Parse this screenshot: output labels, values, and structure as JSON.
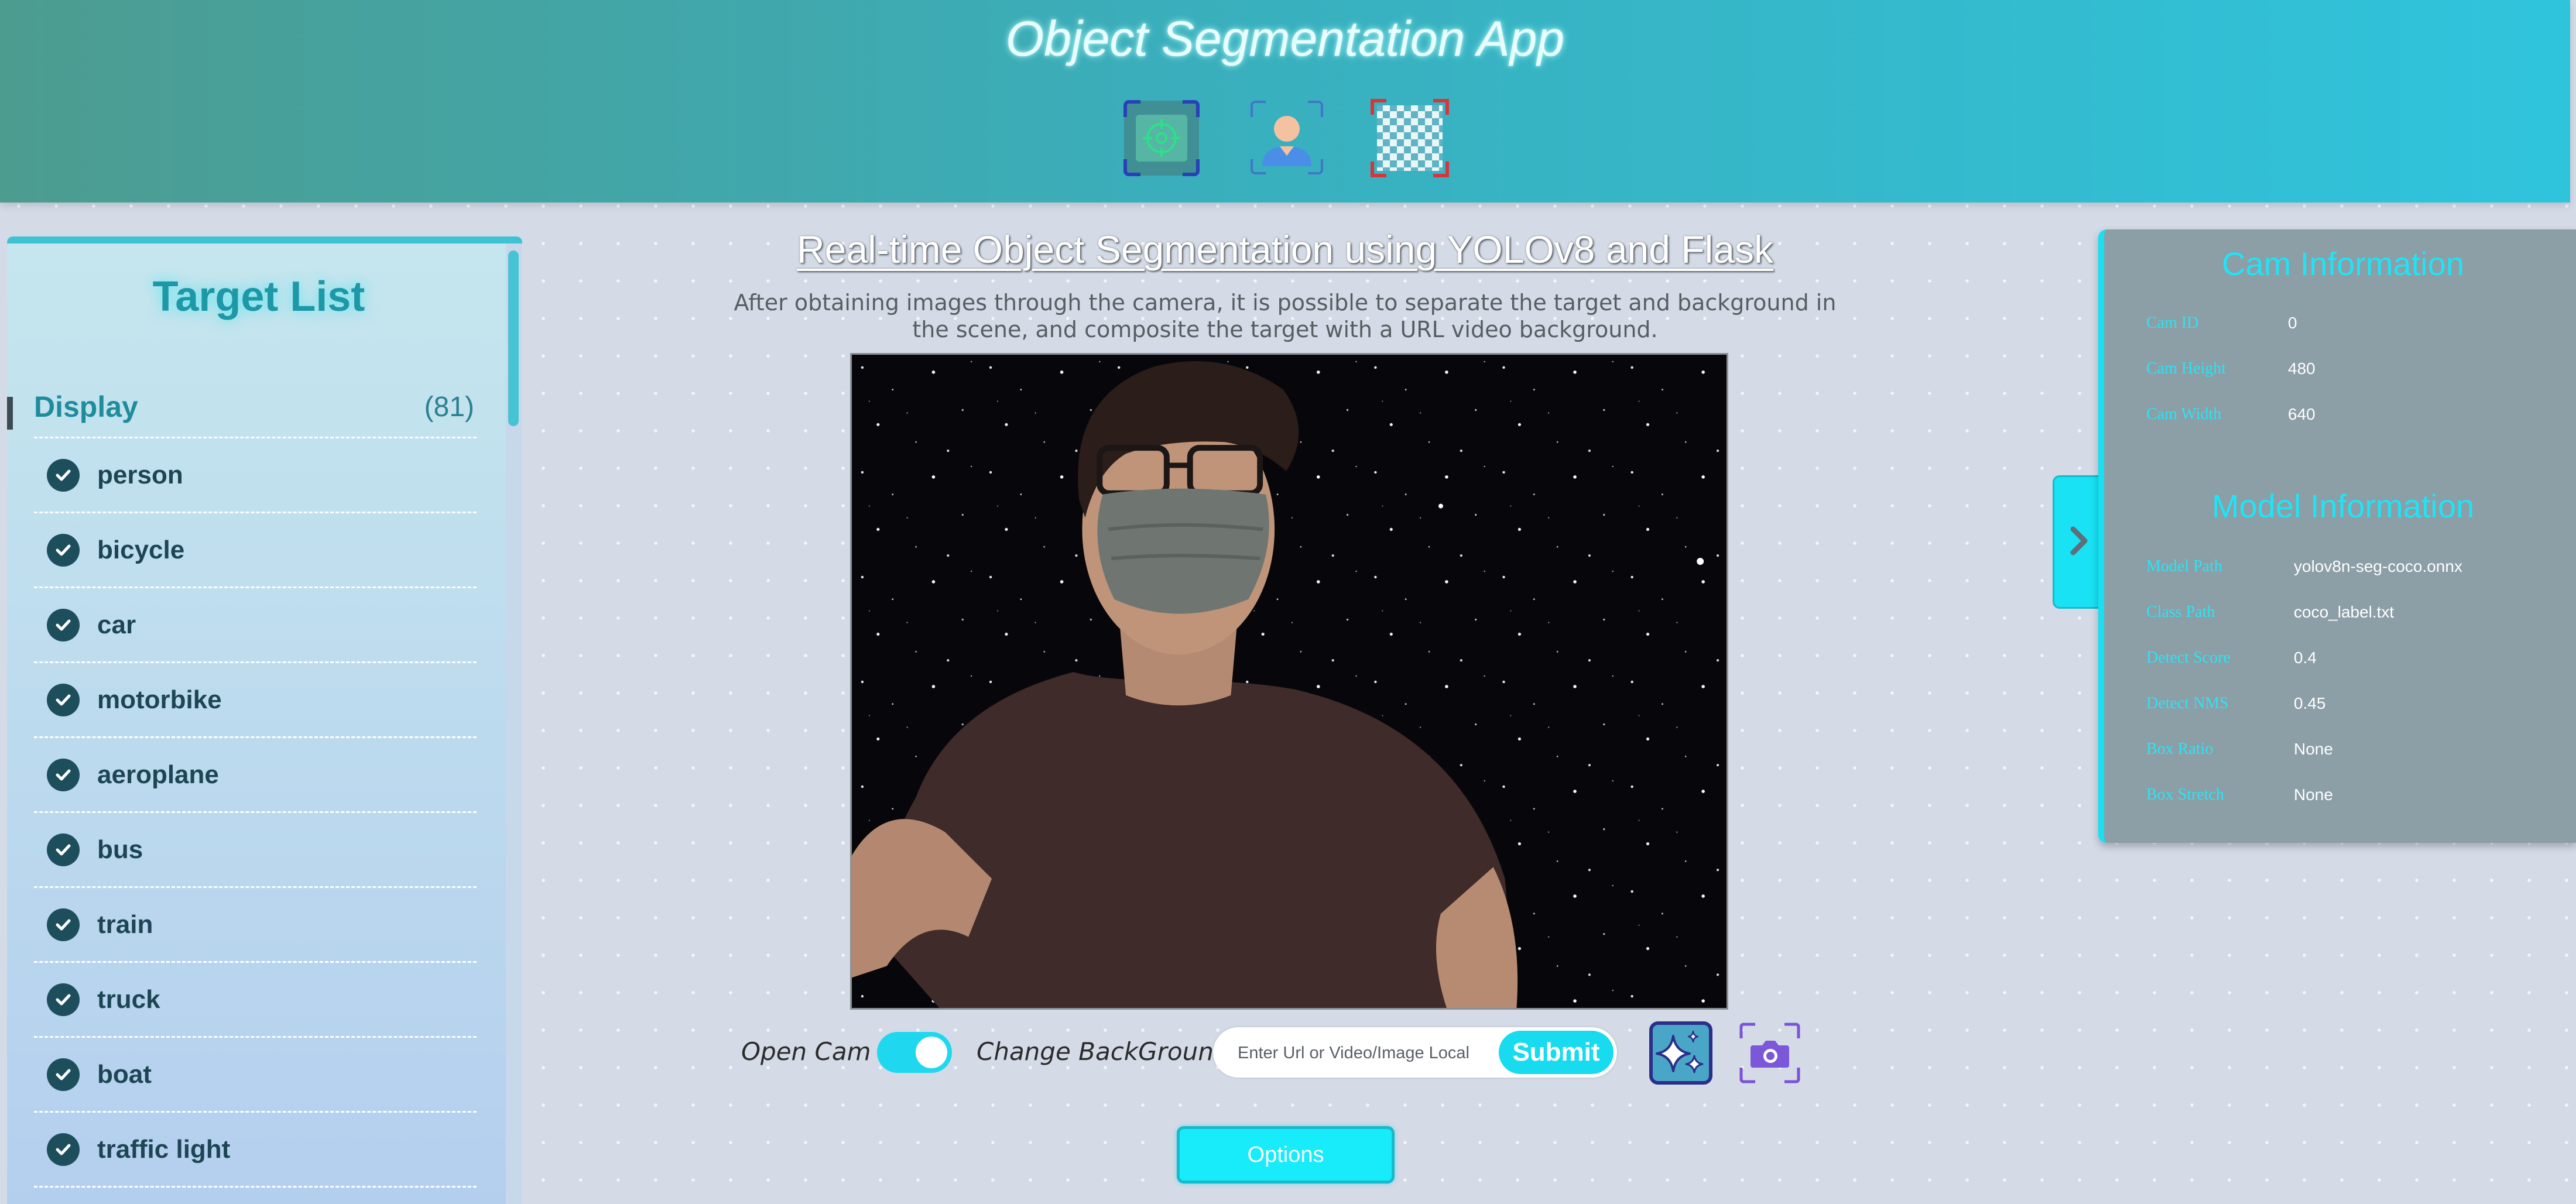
{
  "header": {
    "title": "Object Segmentation App",
    "mode_buttons": [
      {
        "name": "detection",
        "icon": "target-scan-icon"
      },
      {
        "name": "segmentation",
        "icon": "person-portrait-icon"
      },
      {
        "name": "background-removal",
        "icon": "checkerboard-icon"
      }
    ]
  },
  "sidebar": {
    "title": "Target List",
    "group": {
      "label": "Display",
      "count": "(81)"
    },
    "items": [
      {
        "label": "person",
        "checked": true
      },
      {
        "label": "bicycle",
        "checked": true
      },
      {
        "label": "car",
        "checked": true
      },
      {
        "label": "motorbike",
        "checked": true
      },
      {
        "label": "aeroplane",
        "checked": true
      },
      {
        "label": "bus",
        "checked": true
      },
      {
        "label": "train",
        "checked": true
      },
      {
        "label": "truck",
        "checked": true
      },
      {
        "label": "boat",
        "checked": true
      },
      {
        "label": "traffic light",
        "checked": true
      }
    ]
  },
  "main": {
    "title": "Real-time Object Segmentation using YOLOv8 and Flask",
    "description": "After obtaining images through the camera, it is possible to separate the target and background in the scene, and composite the target with a URL video background.",
    "controls": {
      "open_cam_label": "Open Cam :",
      "open_cam_on": true,
      "change_bg_label": "Change BackGround :",
      "bg_input_placeholder": "Enter Url or Video/Image Local",
      "bg_input_value": "",
      "submit_label": "Submit",
      "effects_icon": "sparkles-icon",
      "capture_icon": "camera-icon"
    },
    "options_label": "Options"
  },
  "info_panel": {
    "cam_heading": "Cam Information",
    "cam_rows": [
      {
        "key": "Cam ID",
        "value": "0"
      },
      {
        "key": "Cam Height",
        "value": "480"
      },
      {
        "key": "Cam Width",
        "value": "640"
      }
    ],
    "model_heading": "Model Information",
    "model_rows": [
      {
        "key": "Model Path",
        "value": "yolov8n-seg-coco.onnx"
      },
      {
        "key": "Class Path",
        "value": "coco_label.txt"
      },
      {
        "key": "Detect Score",
        "value": "0.4"
      },
      {
        "key": "Detect NMS",
        "value": "0.45"
      },
      {
        "key": "Box Ratio",
        "value": "None"
      },
      {
        "key": "Box Stretch",
        "value": "None"
      }
    ],
    "toggle_icon": "chevron-right-icon"
  },
  "colors": {
    "accent": "#18dbf0",
    "header_start": "#4c9c90",
    "header_end": "#2fc4dc",
    "panel_bg": "#8c9ea6",
    "check_bg": "#1c4e5c"
  }
}
